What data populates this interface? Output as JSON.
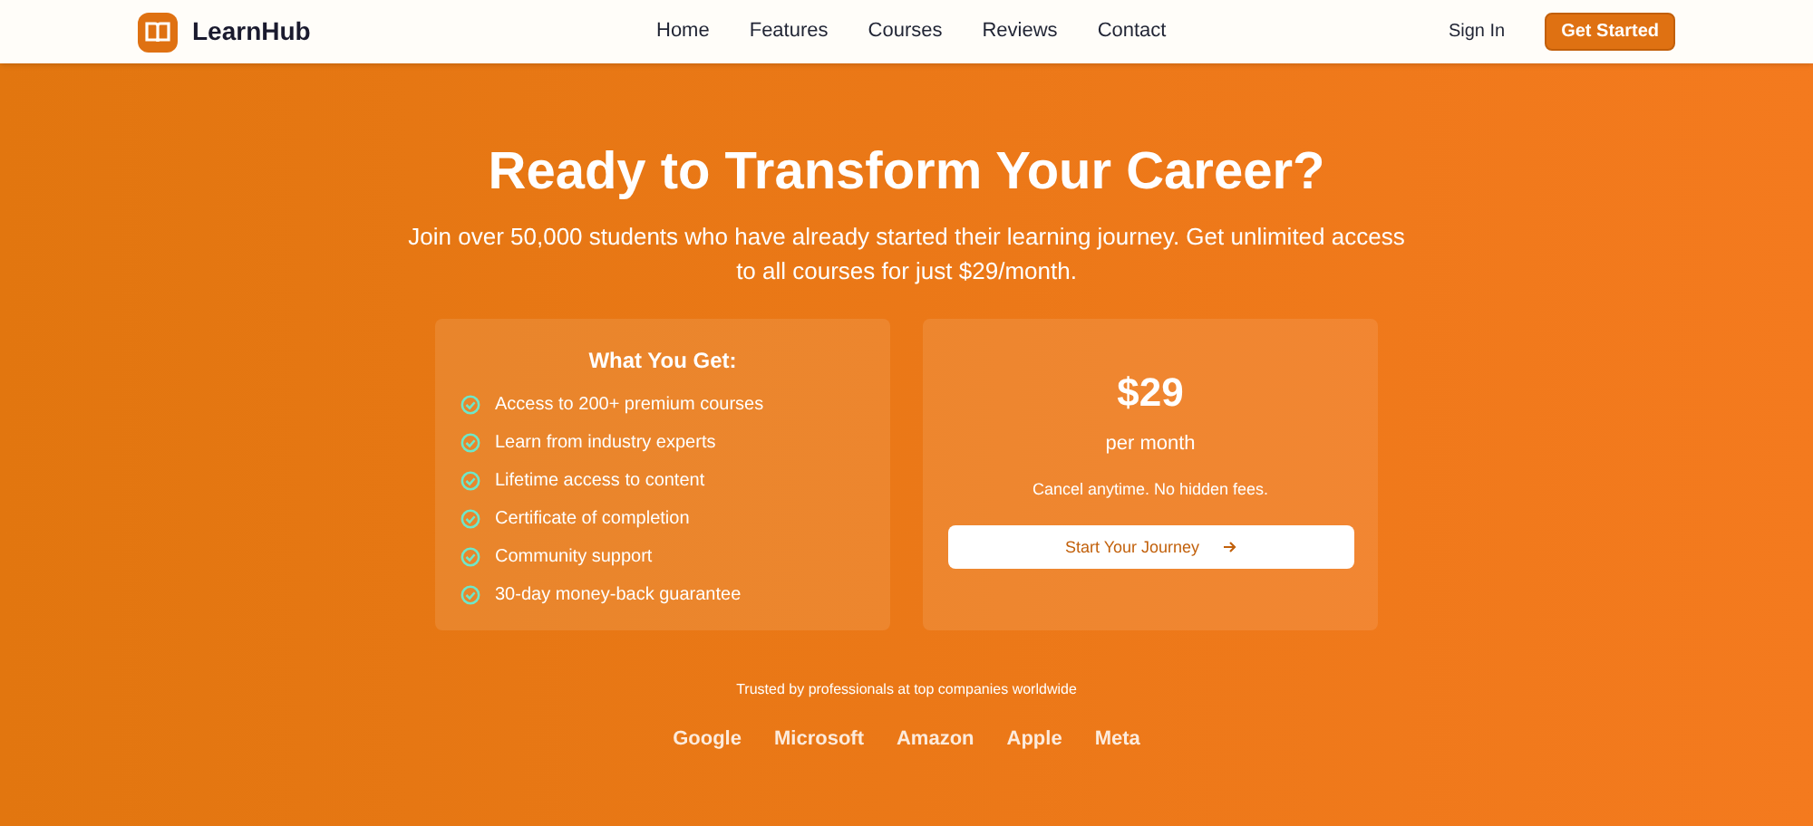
{
  "header": {
    "brand": "LearnHub",
    "nav": [
      "Home",
      "Features",
      "Courses",
      "Reviews",
      "Contact"
    ],
    "sign_in": "Sign In",
    "cta": "Get Started"
  },
  "hero": {
    "title": "Ready to Transform Your Career?",
    "subtitle": "Join over 50,000 students who have already started their learning journey. Get unlimited access to all courses for just $29/month."
  },
  "features_card": {
    "title": "What You Get:",
    "items": [
      "Access to 200+ premium courses",
      "Learn from industry experts",
      "Lifetime access to content",
      "Certificate of completion",
      "Community support",
      "30-day money-back guarantee"
    ]
  },
  "pricing_card": {
    "price": "$29",
    "period": "per month",
    "note": "Cancel anytime. No hidden fees.",
    "button": "Start Your Journey"
  },
  "trust": {
    "caption": "Trusted by professionals at top companies worldwide",
    "companies": [
      "Google",
      "Microsoft",
      "Amazon",
      "Apple",
      "Meta"
    ]
  }
}
